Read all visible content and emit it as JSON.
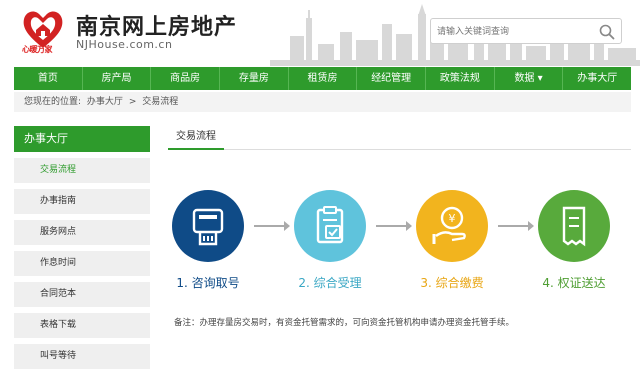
{
  "header": {
    "logo_tag": "心暖万家",
    "site_name": "南京网上房地产",
    "site_domain": "NJHouse.com.cn",
    "search_placeholder": "请输入关键词查询"
  },
  "nav": [
    {
      "label": "首页"
    },
    {
      "label": "房产局"
    },
    {
      "label": "商品房"
    },
    {
      "label": "存量房"
    },
    {
      "label": "租赁房"
    },
    {
      "label": "经纪管理"
    },
    {
      "label": "政策法规"
    },
    {
      "label": "数据 ▾"
    },
    {
      "label": "办事大厅"
    }
  ],
  "breadcrumb": {
    "prefix": "您现在的位置:",
    "level1": "办事大厅",
    "sep": ">",
    "level2": "交易流程"
  },
  "sidebar": {
    "title": "办事大厅",
    "items": [
      {
        "label": "交易流程"
      },
      {
        "label": "办事指南"
      },
      {
        "label": "服务网点"
      },
      {
        "label": "作息时间"
      },
      {
        "label": "合同范本"
      },
      {
        "label": "表格下载"
      },
      {
        "label": "叫号等待"
      }
    ]
  },
  "content": {
    "tab": "交易流程",
    "steps": [
      {
        "label": "1. 咨询取号",
        "color": "#0f4b87"
      },
      {
        "label": "2. 综合受理",
        "color": "#5fc3dc"
      },
      {
        "label": "3. 综合缴费",
        "color": "#f2b41e"
      },
      {
        "label": "4. 权证送达",
        "color": "#58aa3c"
      }
    ],
    "note": "备注：办理存量房交易时，有资金托管需求的，可向资金托管机构申请办理资金托管手续。"
  },
  "colors": {
    "brand_green": "#2e9b2c",
    "logo_red": "#d22222"
  }
}
